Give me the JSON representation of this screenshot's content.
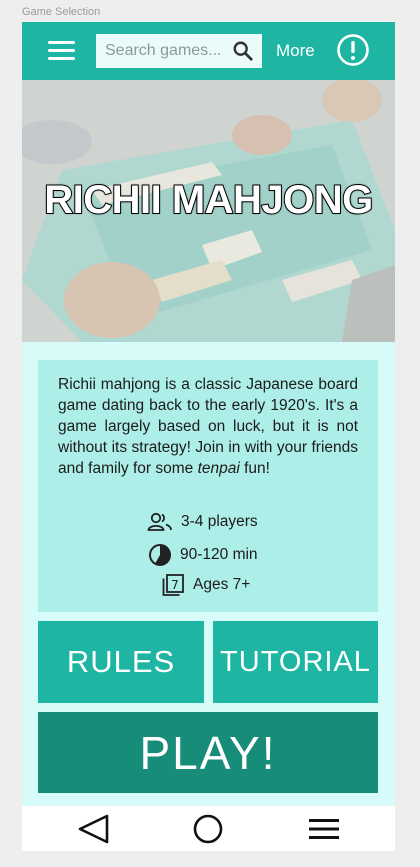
{
  "frame_label": "Game Selection",
  "topbar": {
    "menu_icon": "hamburger-menu-icon",
    "search_placeholder": "Search games...",
    "search_icon": "search-icon",
    "more_label": "More",
    "alert_icon": "exclamation-circle-icon"
  },
  "hero": {
    "title": "RICHII MAHJONG",
    "image": "photo-of-players-at-mahjong-table"
  },
  "description": {
    "text_main": "Richii mahjong is a classic Japanese board game dating back to the early 1920's. It's a game largely based on luck, but it is not without its strategy! Join in with your friends and family for some ",
    "text_emphasis": "tenpai",
    "text_end": " fun!"
  },
  "stats": {
    "players": "3-4 players",
    "time": "90-120 min",
    "ages": "Ages 7+"
  },
  "buttons": {
    "rules": "RULES",
    "tutorial": "TUTORIAL",
    "play": "PLAY!"
  },
  "nav": {
    "back_icon": "back-triangle-icon",
    "home_icon": "home-circle-icon",
    "menu_icon": "menu-lines-icon"
  },
  "colors": {
    "accent": "#1fb5a3",
    "play": "#168c79",
    "background": "#d6fbf8",
    "card": "#aeeee8"
  }
}
